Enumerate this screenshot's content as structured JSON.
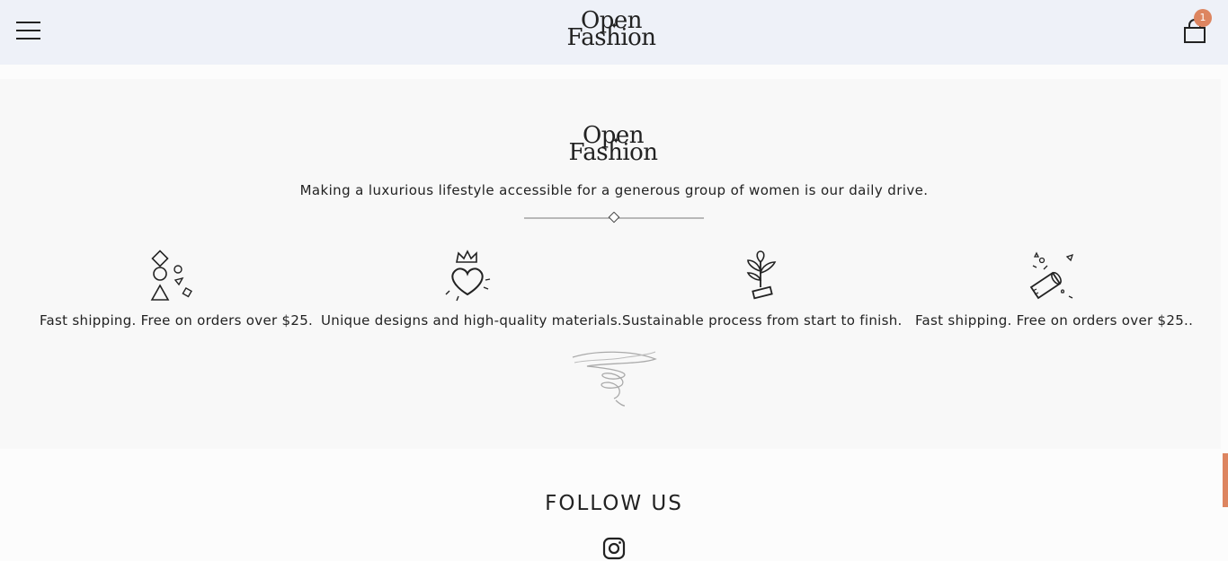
{
  "header": {
    "logo_line1": "Open",
    "logo_line2": "Fashion",
    "cart_count": "1",
    "menu_icon": "hamburger-icon",
    "cart_icon": "shopping-bag-icon"
  },
  "about": {
    "logo_line1": "Open",
    "logo_line2": "Fashion",
    "tagline": "Making a luxurious lifestyle accessible for a generous group of women is our daily drive.",
    "features": [
      {
        "icon": "shapes-icon",
        "text": "Fast shipping. Free on orders over $25."
      },
      {
        "icon": "heart-crown-icon",
        "text": "Unique designs and high-quality materials."
      },
      {
        "icon": "plant-icon",
        "text": "Sustainable process from start to finish."
      },
      {
        "icon": "party-popper-icon",
        "text": "Fast shipping. Free on orders over $25.."
      }
    ]
  },
  "follow": {
    "title": "FOLLOW US",
    "instagram_icon": "instagram-icon"
  },
  "colors": {
    "accent": "#dd8560",
    "header_bg": "#eef1f8",
    "section_bg": "#f8f8f8"
  }
}
